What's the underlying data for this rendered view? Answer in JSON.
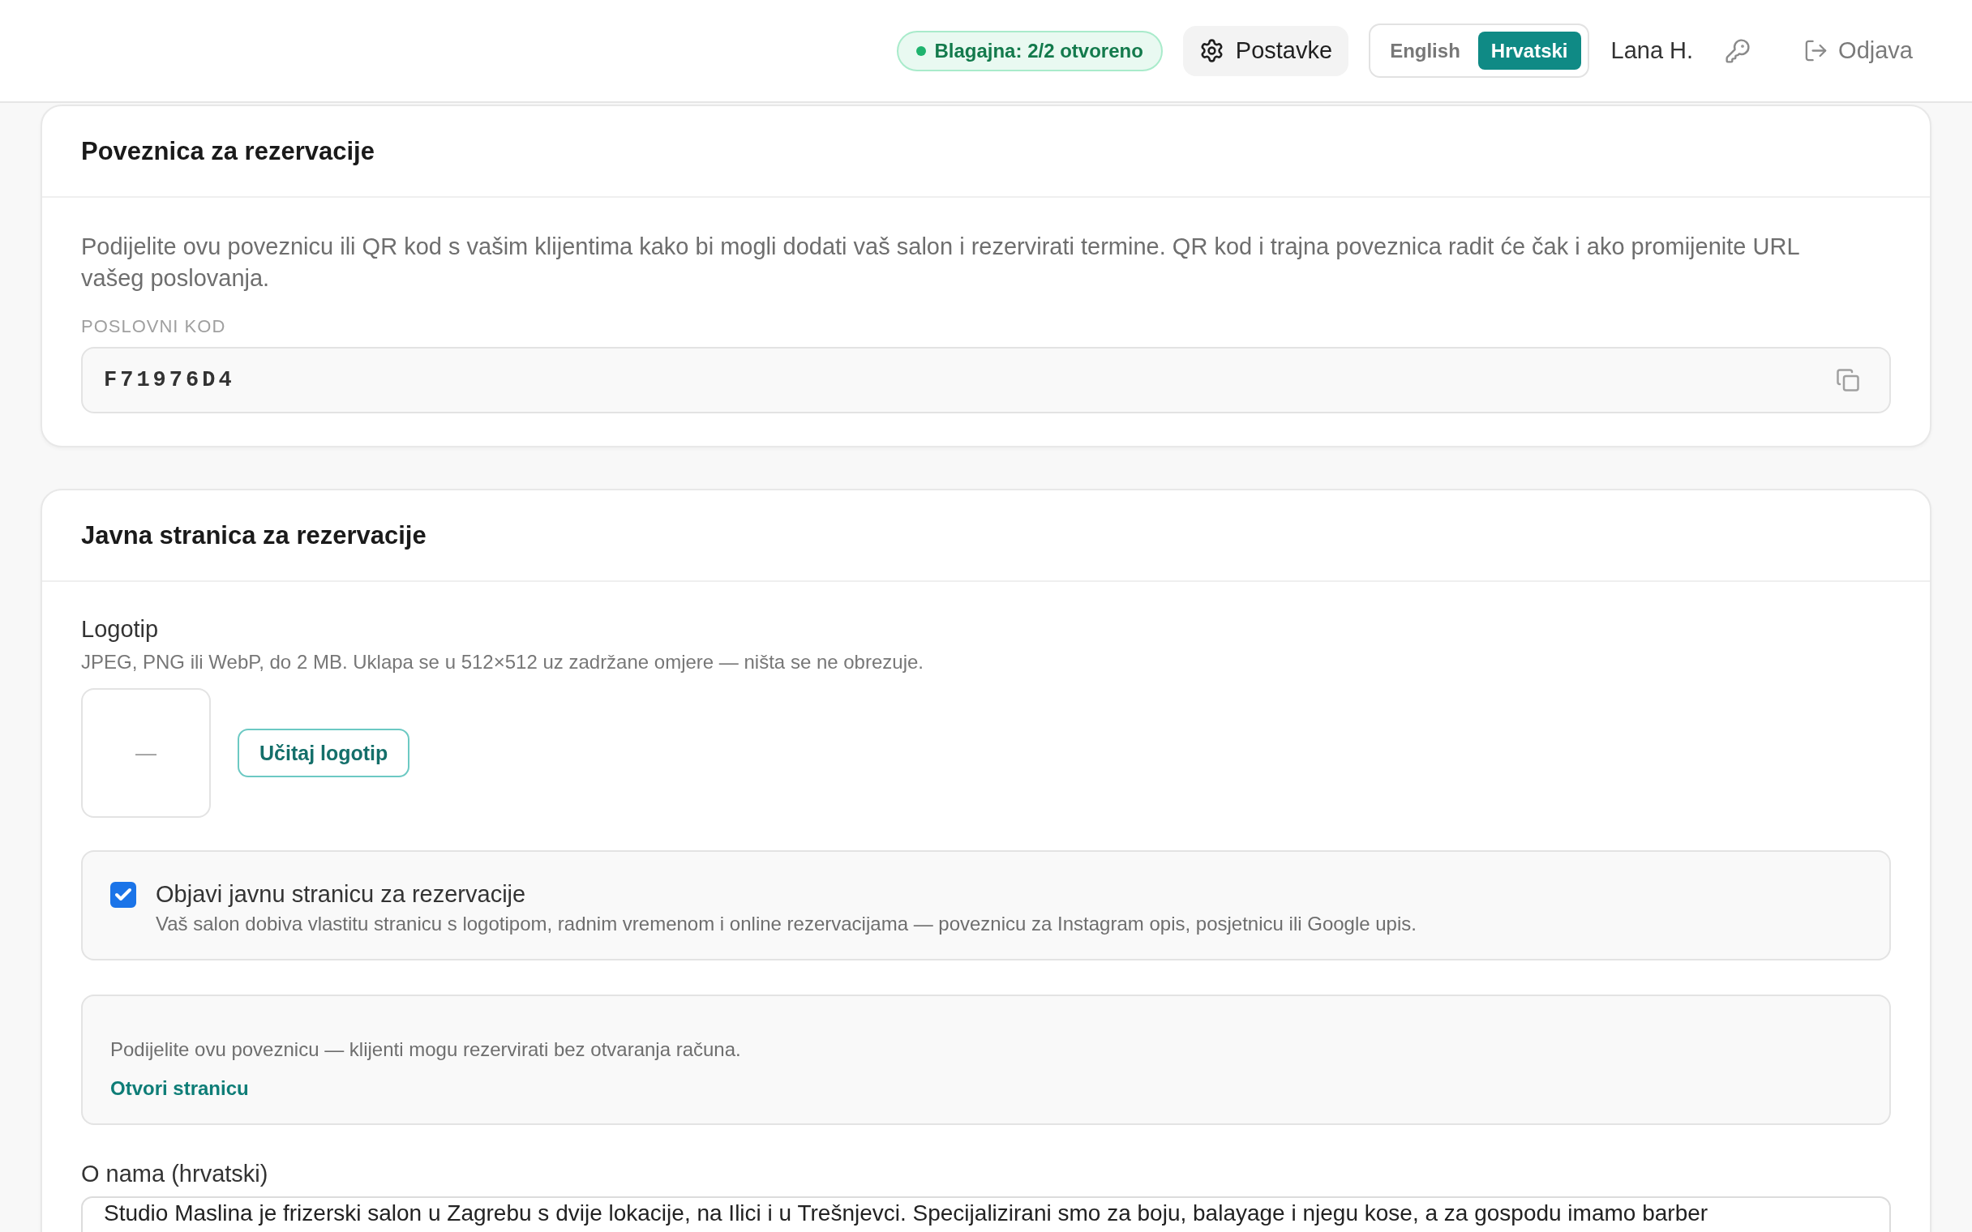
{
  "header": {
    "status_badge": "Blagajna: 2/2 otvoreno",
    "settings_button": "Postavke",
    "languages": [
      {
        "label": "English",
        "selected": false
      },
      {
        "label": "Hrvatski",
        "selected": true
      }
    ],
    "user_name": "Lana H.",
    "logout_button": "Odjava"
  },
  "booking_link": {
    "title": "Poveznica za rezervacije",
    "description": "Podijelite ovu poveznicu ili QR kod s vašim klijentima kako bi mogli dodati vaš salon i rezervirati termine. QR kod i trajna poveznica radit će čak i ako promijenite URL vašeg poslovanja.",
    "code_label": "POSLOVNI KOD",
    "code_value": "F71976D4"
  },
  "public_page": {
    "title": "Javna stranica za rezervacije",
    "logo": {
      "label": "Logotip",
      "hint": "JPEG, PNG ili WebP, do 2 MB. Uklapa se u 512×512 uz zadržane omjere — ništa se ne obrezuje.",
      "preview_text": "—",
      "upload_button": "Učitaj logotip"
    },
    "publish": {
      "label": "Objavi javnu stranicu za rezervacije",
      "description": "Vaš salon dobiva vlastitu stranicu s logotipom, radnim vremenom i online rezervacijama — poveznicu za Instagram opis, posjetnicu ili Google upis.",
      "checked": true
    },
    "share": {
      "text": "Podijelite ovu poveznicu — klijenti mogu rezervirati bez otvaranja računa.",
      "link": "Otvori stranicu"
    },
    "about": {
      "label": "O nama (hrvatski)",
      "value": "Studio Maslina je frizerski salon u Zagrebu s dvije lokacije, na Ilici i u Trešnjevci. Specijalizirani smo za boju, balayage i njegu kose, a za gospodu imamo barber"
    }
  }
}
